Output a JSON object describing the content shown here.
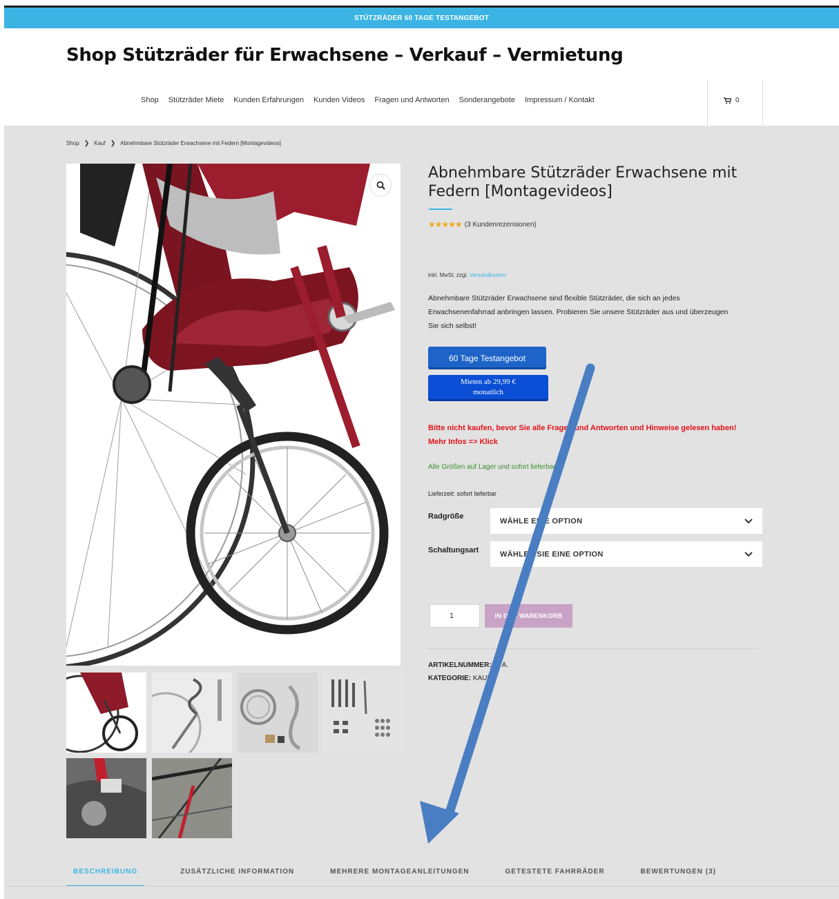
{
  "announcement": "STÜTZRÄDER 60 TAGE TESTANGEBOT",
  "site_title": "Shop Stützräder für Erwachsene – Verkauf – Vermietung",
  "nav": {
    "items": [
      "Shop",
      "Stützräder Miete",
      "Kunden Erfahrungen",
      "Kunden Videos",
      "Fragen und Antworten",
      "Sonderangebote",
      "Impressum / Kontakt"
    ],
    "cart_icon": "cart-icon",
    "cart_count": "0"
  },
  "breadcrumb": [
    "Shop",
    "Kauf",
    "Abnehmbare Stützräder Erwachsene mit Federn [Montagevideos]"
  ],
  "product": {
    "title": "Abnehmbare Stützräder Erwachsene mit Federn [Montagevideos]",
    "rating": 5,
    "stars": "★★★★★",
    "reviews_text": "(3 Kundenrezensionen)",
    "tax_prefix": "inkl. MwSt. zzgl.",
    "tax_link": "Versandkosten",
    "description": "Abnehmbare Stützräder Erwachsene sind flexible Stützräder, die sich an jedes Erwachsenenfahrrad anbringen lassen. Probieren Sie unsere Stützräder aus und überzeugen Sie sich selbst!",
    "btn_test": "60 Tage Testangebot",
    "btn_rent_line1": "Mieten ab 29,99 €",
    "btn_rent_line2": "monatlich",
    "warning": "Bitte nicht kaufen, bevor Sie alle Fragen und Antworten und Hinweise gelesen haben! Mehr Infos => Klick",
    "stock": "Alle Größen auf Lager und sofort lieferbar.",
    "delivery": "Lieferzeit: sofort lieferbar",
    "variations": [
      {
        "label": "Radgröße",
        "value": "WÄHLE EINE OPTION"
      },
      {
        "label": "Schaltungsart",
        "value": "WÄHLEN SIE EINE OPTION"
      }
    ],
    "qty": "1",
    "add_to_cart": "IN DEN WARENKORB",
    "sku_label": "ARTIKELNUMMER:",
    "sku_value": "N. A.",
    "category_label": "KATEGORIE:",
    "category_value": "KAUF"
  },
  "tabs": [
    "BESCHREIBUNG",
    "ZUSÄTZLICHE INFORMATION",
    "MEHRERE MONTAGEANLEITUNGEN",
    "GETESTETE FAHRRÄDER",
    "BEWERTUNGEN (3)"
  ],
  "colors": {
    "accent": "#3bb4e3",
    "button_blue": "#1e64c8",
    "warning": "#e3121a",
    "stock": "#3a8e2c",
    "arrow": "#4a7ec2",
    "bike_red": "#8e1a2a"
  }
}
